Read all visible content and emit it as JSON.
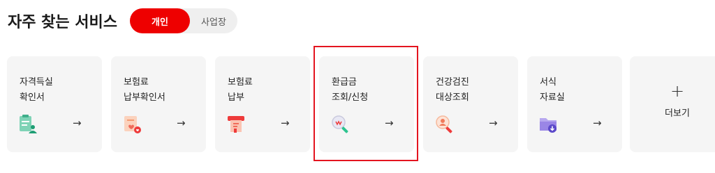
{
  "header": {
    "title": "자주 찾는 서비스",
    "tabs": [
      {
        "label": "개인",
        "active": true
      },
      {
        "label": "사업장",
        "active": false
      }
    ]
  },
  "cards": [
    {
      "line1": "자격득실",
      "line2": "확인서",
      "icon": "document-person-icon"
    },
    {
      "line1": "보험료",
      "line2": "납부확인서",
      "icon": "document-heart-icon"
    },
    {
      "line1": "보험료",
      "line2": "납부",
      "icon": "payment-machine-icon"
    },
    {
      "line1": "환급금",
      "line2": "조회/신청",
      "icon": "search-money-icon"
    },
    {
      "line1": "건강검진",
      "line2": "대상조회",
      "icon": "search-person-icon"
    },
    {
      "line1": "서식",
      "line2": "자료실",
      "icon": "folder-download-icon"
    }
  ],
  "arrow": "→",
  "more": {
    "plus": "+",
    "label": "더보기"
  },
  "colors": {
    "accent": "#ee0000",
    "card_bg": "#f5f5f5",
    "highlight": "#e4141f"
  }
}
